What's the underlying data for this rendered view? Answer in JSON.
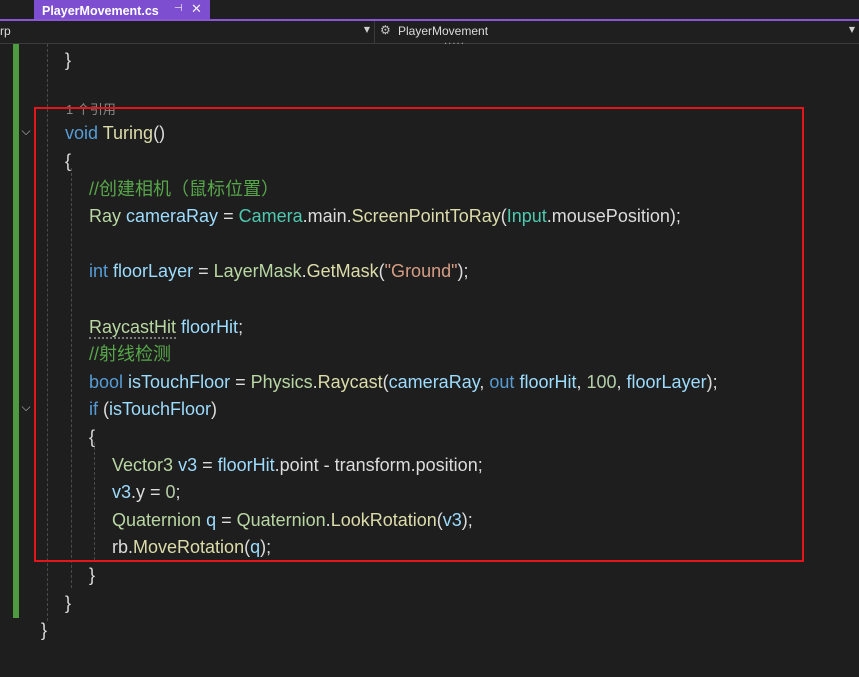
{
  "tab": {
    "title": "PlayerMovement.cs",
    "pin": "⊣",
    "close": "✕"
  },
  "navbar": {
    "left_text": "rp",
    "class_name": "PlayerMovement"
  },
  "colors": {
    "accent": "#7d4fd0",
    "keyword": "#569cd6",
    "type": "#4ec9b0",
    "comment": "#57a64a",
    "number": "#b5cea8",
    "string": "#d69d85",
    "highlight_box": "#e4161c",
    "change_bar": "#4e9a3e"
  },
  "code": {
    "l_prev_brace": "}",
    "codelens": "1 个引用",
    "l_method": {
      "kw": "void",
      "name": "Turing",
      "rest": "()"
    },
    "l_open1": "{",
    "l_c1": "//创建相机（鼠标位置）",
    "l_ray": {
      "t1": "Ray",
      "sp1": " ",
      "v1": "cameraRay",
      "eq": " = ",
      "t2": "Camera",
      "d1": ".main.",
      "f1": "ScreenPointToRay",
      "p1": "(",
      "t3": "Input",
      "d2": ".mousePosition);"
    },
    "l_int": {
      "kw": "int",
      "sp": " ",
      "v": "floorLayer",
      "eq": " = ",
      "t": "LayerMask",
      "d": ".",
      "f": "GetMask",
      "p": "(",
      "s": "\"Ground\"",
      "e": ");"
    },
    "l_hit": {
      "t": "RaycastHit",
      "sp": " ",
      "v": "floorHit",
      "e": ";"
    },
    "l_c2": "//射线检测",
    "l_bool": {
      "kw": "bool",
      "sp": " ",
      "v1": "isTouchFloor",
      "eq": " = ",
      "t": "Physics",
      "d": ".",
      "f": "Raycast",
      "p": "(",
      "v2": "cameraRay",
      "c1": ", ",
      "kw2": "out",
      "sp2": " ",
      "v3": "floorHit",
      "c2": ", ",
      "n": "100",
      "c3": ", ",
      "v4": "floorLayer",
      "e": ");"
    },
    "l_if": {
      "kw": "if",
      "p": " (",
      "v": "isTouchFloor",
      "e": ")"
    },
    "l_open2": "{",
    "l_vec": {
      "t": "Vector3",
      "sp": " ",
      "v1": "v3",
      "eq": " = ",
      "v2": "floorHit",
      "d1": ".point - transform.position;"
    },
    "l_v3y": {
      "v": "v3",
      "d": ".y = ",
      "n": "0",
      "e": ";"
    },
    "l_quat": {
      "t1": "Quaternion",
      "sp": " ",
      "v1": "q",
      "eq": " = ",
      "t2": "Quaternion",
      "d": ".",
      "f": "LookRotation",
      "p": "(",
      "v2": "v3",
      "e": ");"
    },
    "l_rb": {
      "a": "rb.",
      "f": "MoveRotation",
      "p": "(",
      "v": "q",
      "e": ");"
    },
    "l_close2": "}",
    "l_close1": "}",
    "l_close0": "}"
  }
}
